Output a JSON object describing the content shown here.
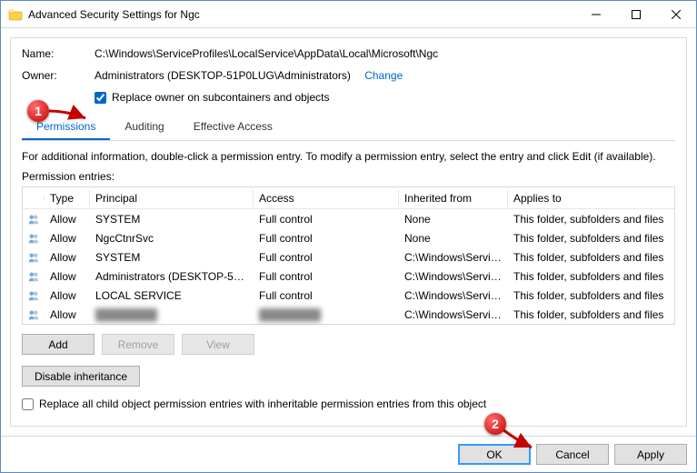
{
  "window": {
    "title": "Advanced Security Settings for Ngc"
  },
  "header": {
    "name_label": "Name:",
    "name_value": "C:\\Windows\\ServiceProfiles\\LocalService\\AppData\\Local\\Microsoft\\Ngc",
    "owner_label": "Owner:",
    "owner_value": "Administrators (DESKTOP-51P0LUG\\Administrators)",
    "change_link": "Change",
    "replace_owner_label": "Replace owner on subcontainers and objects"
  },
  "tabs": [
    {
      "label": "Permissions"
    },
    {
      "label": "Auditing"
    },
    {
      "label": "Effective Access"
    }
  ],
  "hint": "For additional information, double-click a permission entry. To modify a permission entry, select the entry and click Edit (if available).",
  "entries_label": "Permission entries:",
  "columns": {
    "type": "Type",
    "principal": "Principal",
    "access": "Access",
    "inherited": "Inherited from",
    "applies": "Applies to"
  },
  "entries": [
    {
      "type": "Allow",
      "principal": "SYSTEM",
      "access": "Full control",
      "inherited": "None",
      "applies": "This folder, subfolders and files"
    },
    {
      "type": "Allow",
      "principal": "NgcCtnrSvc",
      "access": "Full control",
      "inherited": "None",
      "applies": "This folder, subfolders and files"
    },
    {
      "type": "Allow",
      "principal": "SYSTEM",
      "access": "Full control",
      "inherited": "C:\\Windows\\ServicePr...",
      "applies": "This folder, subfolders and files"
    },
    {
      "type": "Allow",
      "principal": "Administrators (DESKTOP-51P...",
      "access": "Full control",
      "inherited": "C:\\Windows\\ServicePr...",
      "applies": "This folder, subfolders and files"
    },
    {
      "type": "Allow",
      "principal": "LOCAL SERVICE",
      "access": "Full control",
      "inherited": "C:\\Windows\\ServicePr...",
      "applies": "This folder, subfolders and files"
    },
    {
      "type": "Allow",
      "principal": "████████",
      "access": "████████",
      "inherited": "C:\\Windows\\ServicePr...",
      "applies": "This folder, subfolders and files"
    }
  ],
  "buttons": {
    "add": "Add",
    "remove": "Remove",
    "view": "View",
    "disable_inheritance": "Disable inheritance",
    "replace_all_label": "Replace all child object permission entries with inheritable permission entries from this object",
    "ok": "OK",
    "cancel": "Cancel",
    "apply": "Apply"
  },
  "annotations": {
    "badge1": "1",
    "badge2": "2"
  }
}
